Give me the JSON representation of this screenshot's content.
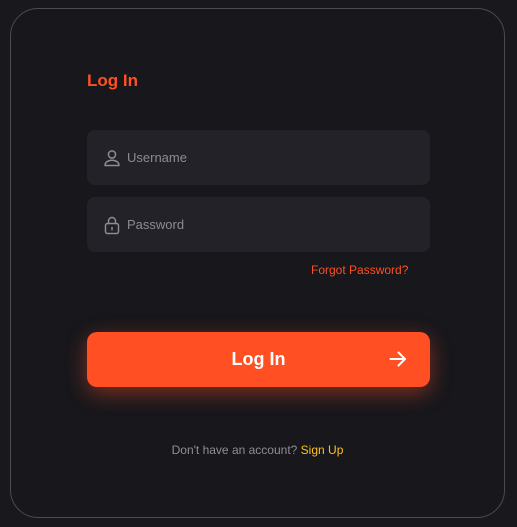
{
  "form": {
    "title": "Log In",
    "username": {
      "placeholder": "Username",
      "value": "",
      "icon": "user-icon"
    },
    "password": {
      "placeholder": "Password",
      "value": "",
      "icon": "lock-icon"
    },
    "forgot_label": "Forgot Password?",
    "submit": {
      "label": "Log In",
      "icon": "arrow-right-icon"
    },
    "signup": {
      "prompt": "Don't have an account?",
      "link_label": "Sign Up"
    }
  },
  "colors": {
    "background": "#18181d",
    "accent": "#ff4f23",
    "link_secondary": "#ffc21a",
    "field_bg": "#222228",
    "border": "#4a4a52"
  }
}
